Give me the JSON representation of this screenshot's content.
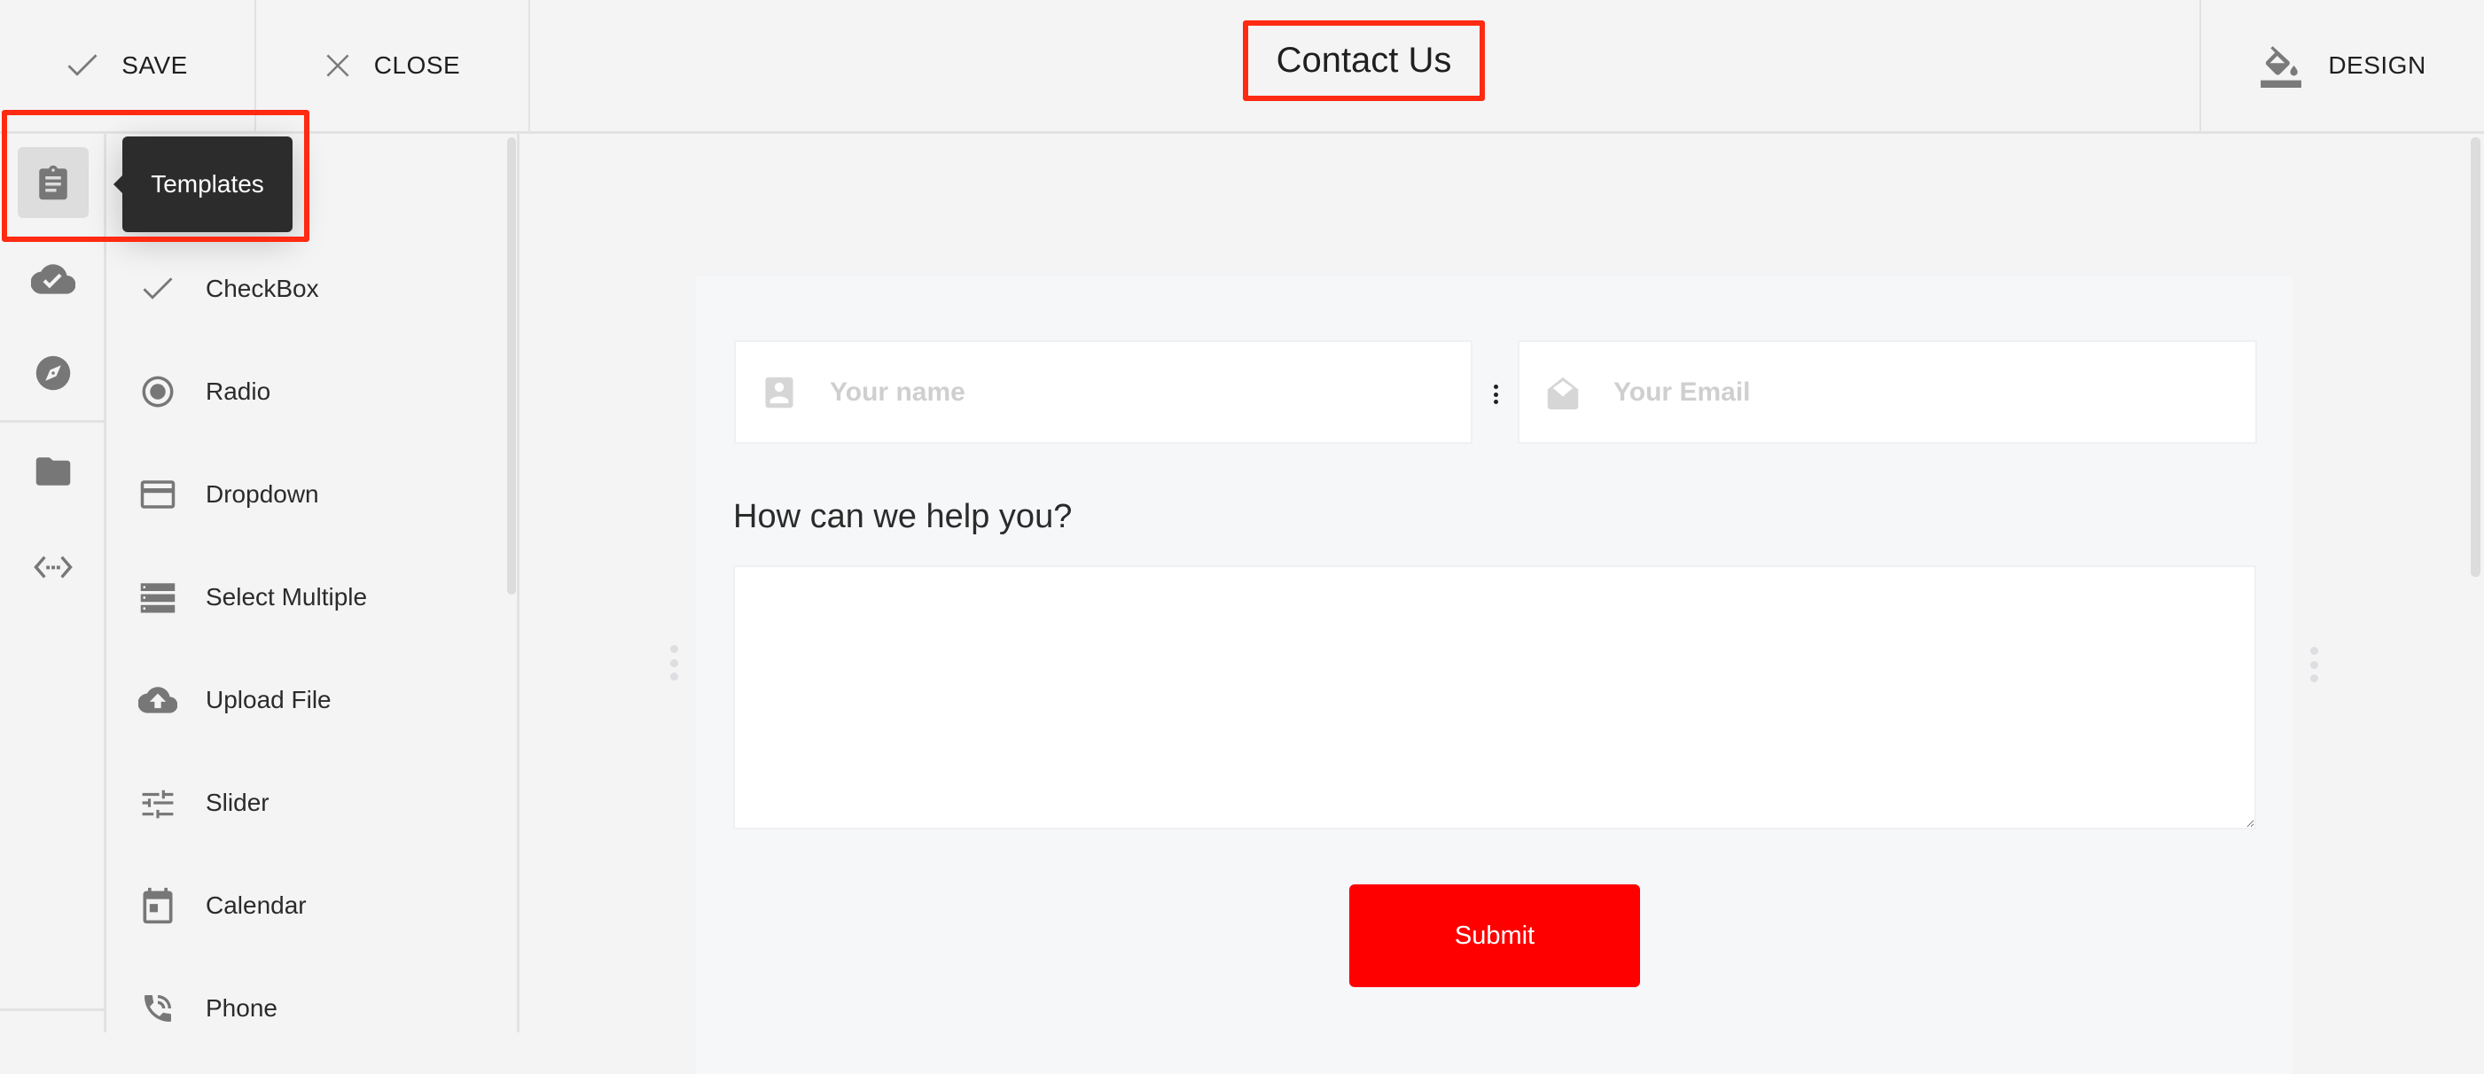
{
  "toolbar": {
    "save_label": "SAVE",
    "close_label": "CLOSE",
    "design_label": "DESIGN",
    "title": "Contact Us"
  },
  "rail": {
    "items": [
      {
        "name": "templates",
        "icon": "clipboard-icon",
        "active": true
      },
      {
        "name": "cloud",
        "icon": "cloud-done-icon",
        "active": false
      },
      {
        "name": "explore",
        "icon": "compass-icon",
        "active": false
      },
      {
        "name": "files",
        "icon": "folder-icon",
        "active": false
      },
      {
        "name": "embed",
        "icon": "code-dots-icon",
        "active": false
      }
    ],
    "tooltip": "Templates"
  },
  "panel": {
    "items": [
      {
        "label": "CheckBox",
        "icon": "check-icon"
      },
      {
        "label": "Radio",
        "icon": "radio-icon"
      },
      {
        "label": "Dropdown",
        "icon": "dropdown-icon"
      },
      {
        "label": "Select Multiple",
        "icon": "list-icon"
      },
      {
        "label": "Upload File",
        "icon": "cloud-upload-icon"
      },
      {
        "label": "Slider",
        "icon": "tune-icon"
      },
      {
        "label": "Calendar",
        "icon": "calendar-icon"
      },
      {
        "label": "Phone",
        "icon": "phone-icon"
      }
    ]
  },
  "form": {
    "name_placeholder": "Your name",
    "email_placeholder": "Your Email",
    "help_label": "How can we help you?",
    "message_value": "",
    "submit_label": "Submit"
  },
  "colors": {
    "accent": "#ff0000",
    "annotation": "#ff2a12",
    "tooltip_bg": "#2c2c2c",
    "icon": "#777777"
  }
}
